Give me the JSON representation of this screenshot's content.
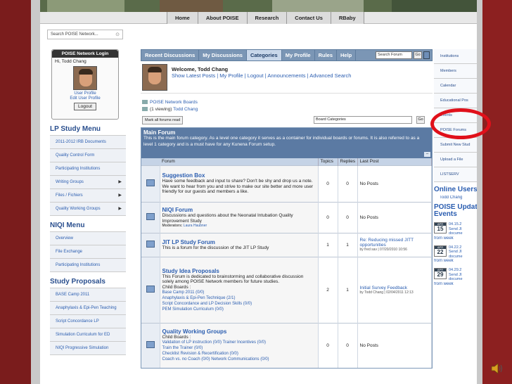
{
  "topnav": [
    "Home",
    "About POISE",
    "Research",
    "Contact Us",
    "RBaby"
  ],
  "search": {
    "placeholder": "Search POISE Network..."
  },
  "login": {
    "title": "POISE Network Login",
    "greeting": "Hi, Todd Chang",
    "profile_link": "User Profile",
    "edit_link": "Edit User Profile",
    "logout": "Logout"
  },
  "lp_menu": {
    "title": "LP Study Menu",
    "items": [
      "2011-2012 IRB Documents",
      "Quality Control Form",
      "Participating Institutions",
      "Writing Groups",
      "Files / Fichiers",
      "Quality Working Groups"
    ],
    "arrow_items": [
      3,
      4,
      5
    ]
  },
  "niqi_menu": {
    "title": "NIQI Menu",
    "items": [
      "Overview",
      "File Exchange",
      "Participating Institutions"
    ]
  },
  "study_proposals": {
    "title": "Study Proposals",
    "items": [
      "BASE Camp 2011",
      "Anaphylaxis & Epi-Pen Teaching",
      "Script Concordance LP",
      "Simulation Curriculum for ED",
      "NIQI Progressive Simulation"
    ]
  },
  "tabs": [
    {
      "label": "Recent Discussions",
      "active": false
    },
    {
      "label": "My Discussions",
      "active": false
    },
    {
      "label": "Categories",
      "active": true
    },
    {
      "label": "My Profile",
      "active": false
    },
    {
      "label": "Rules",
      "active": false
    },
    {
      "label": "Help",
      "active": false
    }
  ],
  "tab_search": {
    "value": "Search Forum",
    "go": "Go"
  },
  "welcome": {
    "text": "Welcome, Todd Chang",
    "links": "Show Latest Posts | My Profile | Logout | Announcements | Advanced Search"
  },
  "breadcrumb": {
    "board": "POISE Network Boards",
    "viewing_count": "(1 viewing)",
    "viewing_user": "Todd Chang"
  },
  "actions": {
    "mark_read": "Mark all forums read",
    "category_select": "Board Categories",
    "go": "Go"
  },
  "main_forum": {
    "title": "Main Forum",
    "description": "This is the main forum category. As a level one category it serves as a container for individual boards or forums. It is also referred to as a level 1 category and is a must have for any Kunena Forum setup.",
    "collapse": "–"
  },
  "table_headers": {
    "forum": "Forum",
    "topics": "Topics",
    "replies": "Replies",
    "last_post": "Last Post"
  },
  "forums": [
    {
      "title": "Suggestion Box",
      "desc": "Have some feedback and input to share? Don't be shy and drop us a note. We want to hear from you and strive to make our site better and more user friendly for our guests and members a like.",
      "topics": "0",
      "replies": "0",
      "last": "No Posts"
    },
    {
      "title": "NIQI Forum",
      "desc": "Discussions and questions about the Neonatal Intubation Quality Improvement Study",
      "mod_label": "Moderators:",
      "mod_name": "Laura Haubner",
      "topics": "0",
      "replies": "0",
      "last": "No Posts"
    },
    {
      "title": "JIT LP Study Forum",
      "desc": "This is a forum for the discussion of the JIT LP Study",
      "topics": "1",
      "replies": "1",
      "last": "Re: Reducing missed JITT opportunities",
      "last_sub": "by fred sav | 07/20/2010 10:56"
    },
    {
      "title": "Study Idea Proposals",
      "desc": "This Forum is dedicated to brainstorming and collaborative discussion solely among POISE Network members for future studies.",
      "child_label": "Child Boards :",
      "children": [
        "Base Camp 2011 (0/0)",
        "Anaphylaxis & Epi-Pen Technique (2/1)",
        "Script Concordance and LP Decision Skills (0/0)",
        "PEM Simulation Curriculum (0/0)"
      ],
      "topics": "2",
      "replies": "1",
      "last": "Initial Survey Feedback",
      "last_sub": "by Todd Chang | 02/04/2011 12:13"
    },
    {
      "title": "Quality Working Groups",
      "child_label": "Child Boards :",
      "children": [
        "Validation of LP instruction (0/0)  Trainer Incentives (0/0)",
        "Train the Trainer (0/0)",
        "Checklist Revision & Recertification (0/0)",
        "Coach vs. no Coach (0/0)  Network Communications (0/0)"
      ],
      "topics": "0",
      "replies": "0",
      "last": "No Posts"
    }
  ],
  "right_links": [
    "Institutions",
    "Members",
    "Calendar",
    "Educational Pos",
    "Events",
    "POISE Forums",
    "Submit New Stud",
    "Upload a File",
    "LISTSERV"
  ],
  "online": {
    "title": "Online Users",
    "user": "Todd Chang"
  },
  "updates": {
    "title": "POISE Updates",
    "title2": "Events",
    "entries": [
      {
        "month": "APR",
        "day": "15",
        "lines": [
          "04.15.2",
          "Send JI",
          "docume"
        ],
        "from": "from week"
      },
      {
        "month": "APR",
        "day": "22",
        "lines": [
          "04.22.2",
          "Send JI",
          "docume"
        ],
        "from": "from week"
      },
      {
        "month": "APR",
        "day": "29",
        "lines": [
          "04.29.2",
          "Send JI",
          "docume"
        ],
        "from": "from week"
      }
    ]
  },
  "colors": {
    "frame": "#7a1c1c",
    "accent": "#2a5db0",
    "highlight_ring": "#e0101a"
  }
}
